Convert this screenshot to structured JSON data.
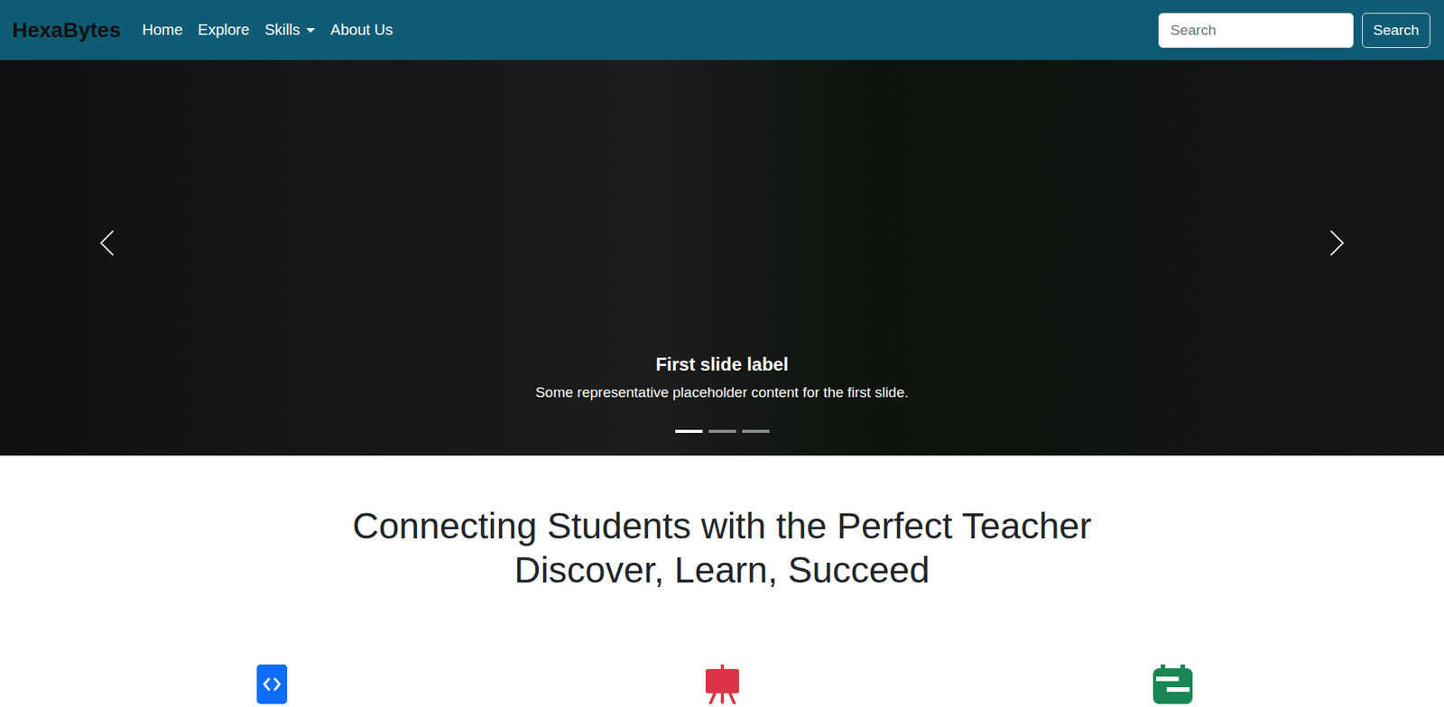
{
  "navbar": {
    "brand": "HexaBytes",
    "links": [
      {
        "label": "Home",
        "dropdown": false
      },
      {
        "label": "Explore",
        "dropdown": false
      },
      {
        "label": "Skills",
        "dropdown": true
      },
      {
        "label": "About Us",
        "dropdown": false
      }
    ],
    "search": {
      "placeholder": "Search",
      "button": "Search"
    }
  },
  "carousel": {
    "caption": {
      "title": "First slide label",
      "text": "Some representative placeholder content for the first slide."
    },
    "indicators": [
      {
        "selected": true
      },
      {
        "selected": false
      },
      {
        "selected": false
      }
    ]
  },
  "hero": {
    "lines": [
      "Connecting Students with the Perfect Teacher",
      "Discover, Learn, Succeed"
    ]
  },
  "features": [
    {
      "kind": "code",
      "color": "#0d6efd"
    },
    {
      "kind": "easel",
      "color": "#dc3545"
    },
    {
      "kind": "calendar",
      "color": "#198754"
    }
  ]
}
